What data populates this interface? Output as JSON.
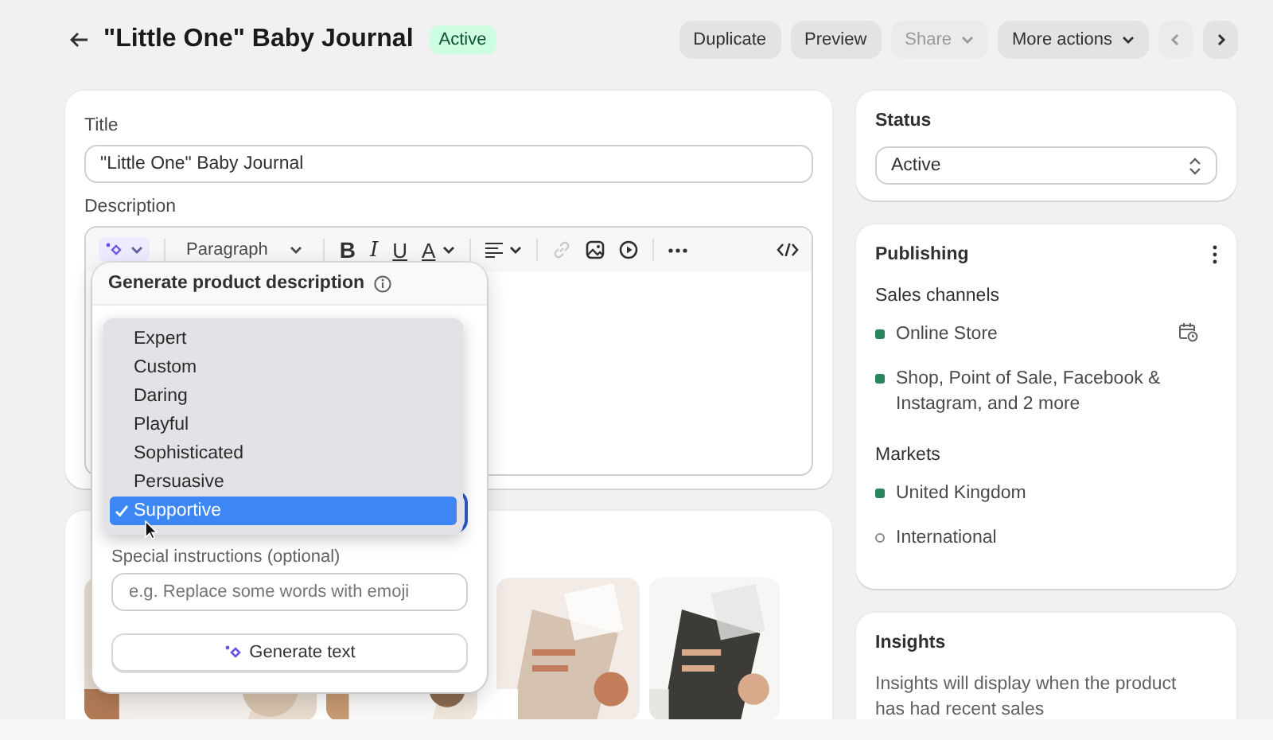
{
  "header": {
    "title": "\"Little One\" Baby Journal",
    "status_badge": "Active",
    "actions": [
      {
        "label": "Duplicate",
        "kind": "button",
        "disabled": false
      },
      {
        "label": "Preview",
        "kind": "button",
        "disabled": false
      },
      {
        "label": "Share",
        "kind": "menu",
        "disabled": true
      },
      {
        "label": "More actions",
        "kind": "menu",
        "disabled": false
      }
    ],
    "pager": [
      {
        "kind": "previous",
        "disabled": true
      },
      {
        "kind": "next",
        "disabled": false
      }
    ]
  },
  "product": {
    "title_label": "Title",
    "title_value": "\"Little One\" Baby Journal",
    "description_label": "Description",
    "toolbar": {
      "block_format": "Paragraph",
      "link_disabled": true,
      "format_buttons": [
        {
          "label": "B",
          "kind": "bold"
        },
        {
          "label": "I",
          "kind": "italic"
        },
        {
          "label": "U",
          "kind": "underline"
        },
        {
          "label": "A",
          "kind": "color"
        }
      ]
    }
  },
  "generate_panel": {
    "title": "Generate product description",
    "tone_options": [
      {
        "label": "Expert",
        "selected": false
      },
      {
        "label": "Custom",
        "selected": false
      },
      {
        "label": "Daring",
        "selected": false
      },
      {
        "label": "Playful",
        "selected": false
      },
      {
        "label": "Sophisticated",
        "selected": false
      },
      {
        "label": "Persuasive",
        "selected": false
      },
      {
        "label": "Supportive",
        "selected": true
      }
    ],
    "instructions_label": "Special instructions (optional)",
    "instructions_placeholder": "e.g. Replace some words with emoji",
    "generate_button": "Generate text"
  },
  "status": {
    "heading": "Status",
    "value": "Active"
  },
  "publishing": {
    "heading": "Publishing",
    "sales_channels_label": "Sales channels",
    "channels": [
      {
        "name": "Online Store",
        "published": true
      },
      {
        "name": "Shop, Point of Sale, Facebook & Instagram, and 2 more",
        "published": true
      }
    ],
    "markets_label": "Markets",
    "markets": [
      {
        "name": "United Kingdom",
        "published": true
      },
      {
        "name": "International",
        "published": false
      }
    ]
  },
  "insights": {
    "heading": "Insights",
    "text": "Insights will display when the product has had recent sales"
  }
}
